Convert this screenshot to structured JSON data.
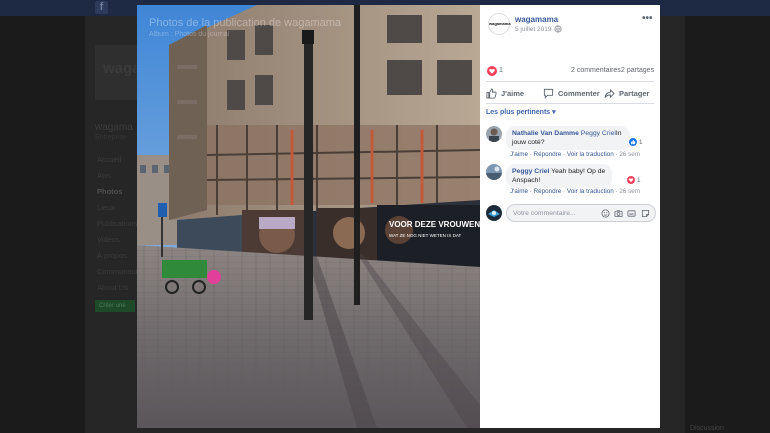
{
  "background": {
    "page_brand": "waga",
    "page_name": "wagama",
    "page_sub": "Entreprise",
    "nav_items": [
      "Accueil",
      "Avis",
      "Photos",
      "Lieux",
      "Publications",
      "Vidéos",
      "À propos",
      "Communauté",
      "About Us"
    ],
    "active_nav": "Photos",
    "green_button": "Créer une",
    "bottom_right_text": "Discussion"
  },
  "photo": {
    "caption": "Photos de la publication de wagamama",
    "caption_sub": "Album : Photos du journal",
    "billboard_text_1": "VOOR DEZE VROUWEN",
    "billboard_text_2": "WAT ZE NOG NIET WETEN IS DAT"
  },
  "post": {
    "avatar_text": "wagamama",
    "page_name": "wagamama",
    "date": "5 juillet 2019",
    "reaction_count": "1",
    "comments_count": "2 commentaires",
    "shares_count": "2 partages",
    "actions": {
      "like": "J'aime",
      "comment": "Commenter",
      "share": "Partager"
    },
    "sort_label": "Les plus pertinents ▾",
    "comments": [
      {
        "author": "Nathalie Van Damme",
        "mention": "Peggy Criel",
        "text": "In jouw coté?",
        "like": "J'aime",
        "reply": "Répondre",
        "translate": "Voir la traduction",
        "time": "26 sem",
        "reaction_count": "1",
        "reaction_type": "like"
      },
      {
        "author": "Peggy Criel",
        "mention": "",
        "text": "Yeah baby! Op de Anspach!",
        "like": "J'aime",
        "reply": "Répondre",
        "translate": "Voir la traduction",
        "time": "26 sem",
        "reaction_count": "1",
        "reaction_type": "love"
      }
    ],
    "composer_placeholder": "Votre commentaire..."
  },
  "colors": {
    "link": "#385898",
    "accent": "#4267b2",
    "love": "#f33e58",
    "like": "#1877f2"
  }
}
